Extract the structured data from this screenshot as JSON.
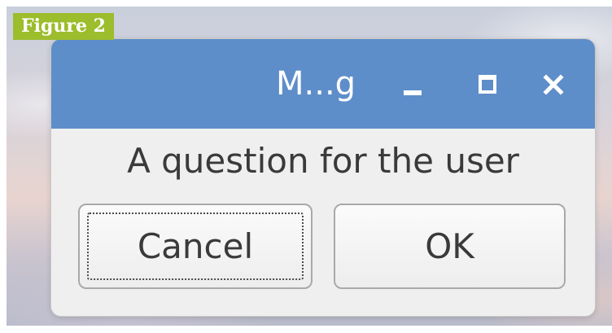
{
  "figure_label": "Figure 2",
  "window": {
    "title": "M...g",
    "controls": {
      "minimize_icon": "minimize-icon",
      "maximize_icon": "maximize-icon",
      "close_icon": "close-icon"
    },
    "titlebar_color": "#5e8ec9"
  },
  "dialog": {
    "message": "A question for the user",
    "buttons": {
      "cancel_label": "Cancel",
      "ok_label": "OK"
    },
    "focused_button": "Cancel"
  },
  "colors": {
    "figure_label_bg": "#9cbd2c"
  }
}
